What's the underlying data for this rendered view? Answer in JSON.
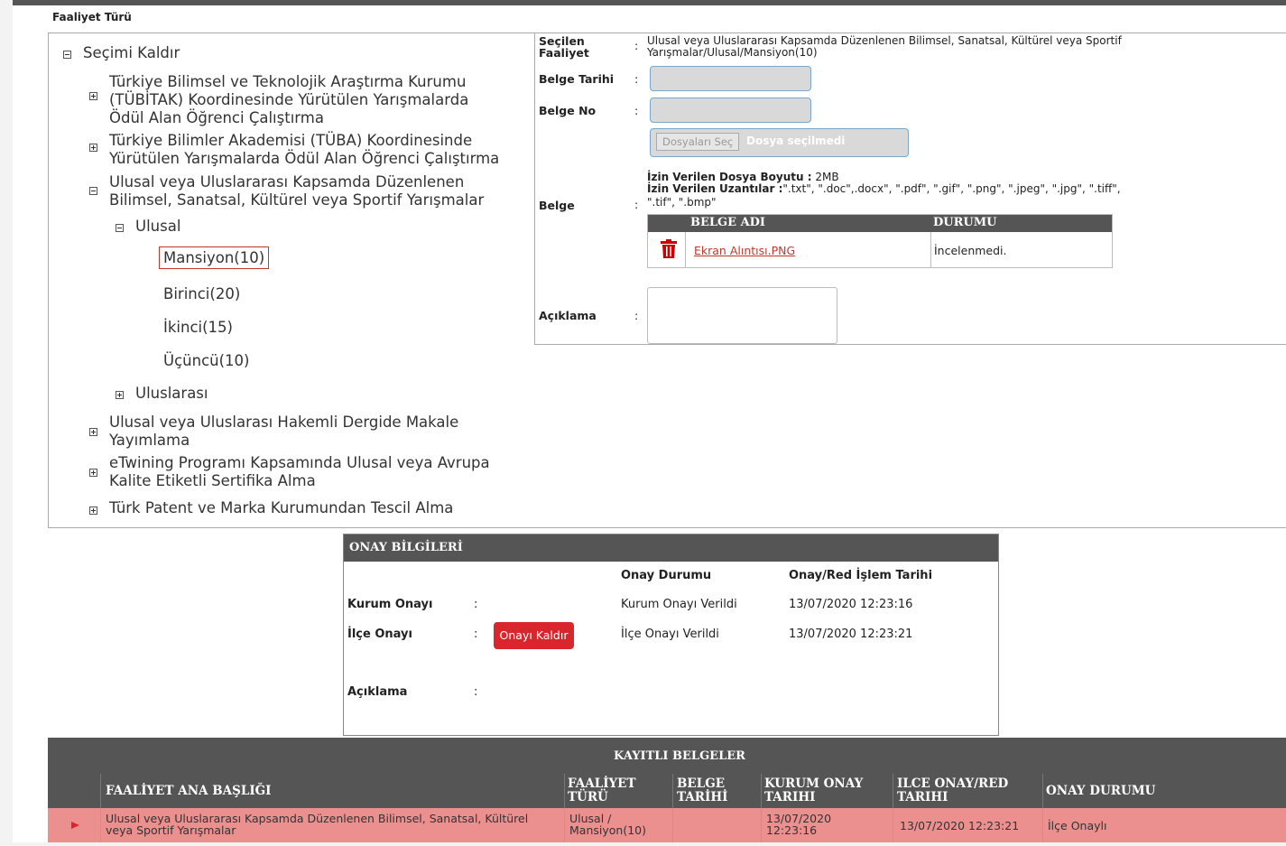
{
  "fieldset_title": "Faaliyet Türü",
  "tree": {
    "clear_selection": "Seçimi Kaldır",
    "items": [
      "Türkiye Bilimsel ve Teknolojik Araştırma Kurumu",
      "(TÜBİTAK) Koordinesinde Yürütülen Yarışmalarda",
      "Ödül Alan Öğrenci Çalıştırma",
      "Türkiye Bilimler Akademisi (TÜBA) Koordinesinde",
      "Yürütülen Yarışmalarda Ödül Alan Öğrenci Çalıştırma",
      "Ulusal veya Uluslararası Kapsamda Düzenlenen",
      "Bilimsel, Sanatsal, Kültürel veya Sportif Yarışmalar",
      "Ulusal",
      "Mansiyon(10)",
      "Birinci(20)",
      "İkinci(15)",
      "Üçüncü(10)",
      "Uluslarası",
      "Ulusal veya Uluslarası Hakemli Dergide Makale",
      "Yayımlama",
      "eTwining Programı Kapsamında Ulusal veya Avrupa",
      "Kalite Etiketli Sertifika Alma",
      "Türk Patent ve Marka Kurumundan Tescil Alma"
    ]
  },
  "detail": {
    "secilen_label_1": "Seçilen",
    "secilen_label_2": "Faaliyet",
    "secilen_value_1": "Ulusal veya Uluslararası Kapsamda Düzenlenen Bilimsel, Sanatsal, Kültürel veya Sportif",
    "secilen_value_2": "Yarışmalar/Ulusal/Mansiyon(10)",
    "belge_tarihi_label": "Belge Tarihi",
    "belge_no_label": "Belge No",
    "file_button": "Dosyaları Seç",
    "file_status": "Dosya seçilmedi",
    "izin_boyut_label": "İzin Verilen Dosya Boyutu :",
    "izin_boyut_value": "2MB",
    "izin_uzanti_label": "İzin Verilen Uzantılar :",
    "izin_uzanti_value_1": "\".txt\", \".doc\",.docx\", \".pdf\", \".gif\", \".png\", \".jpeg\", \".jpg\", \".tiff\",",
    "izin_uzanti_value_2": "\".tif\", \".bmp\"",
    "belge_label": "Belge",
    "col_belge_adi": "BELGE ADI",
    "col_durumu": "DURUMU",
    "file_name": "Ekran Alıntısı.PNG",
    "file_status_text": "İncelenmedi.",
    "aciklama_label": "Açıklama",
    "colon": ":"
  },
  "onay": {
    "title": "ONAY BİLGİLERİ",
    "col_durum": "Onay Durumu",
    "col_tarih": "Onay/Red İşlem Tarihi",
    "kurum_label": "Kurum Onayı",
    "kurum_durum": "Kurum Onayı Verildi",
    "kurum_tarih": "13/07/2020 12:23:16",
    "ilce_label": "İlçe Onayı",
    "ilce_button": "Onayı Kaldır",
    "ilce_durum": "İlçe Onayı Verildi",
    "ilce_tarih": "13/07/2020 12:23:21",
    "aciklama_label": "Açıklama",
    "colon": ":"
  },
  "kayitli": {
    "title": "KAYITLI BELGELER",
    "columns": {
      "ana_baslik": "FAALİYET ANA BAŞLIĞI",
      "turu_1": "FAALİYET",
      "turu_2": "TÜRÜ",
      "belge_1": "BELGE",
      "belge_2": "TARİHİ",
      "kurum_1": "KURUM ONAY",
      "kurum_2": "TARIHI",
      "ilce_1": "ILCE ONAY/RED",
      "ilce_2": "TARIHI",
      "durum": "ONAY DURUMU"
    },
    "row": {
      "ana_baslik_1": "Ulusal veya Uluslararası Kapsamda Düzenlenen Bilimsel, Sanatsal, Kültürel",
      "ana_baslik_2": "veya Sportif Yarışmalar",
      "turu_1": "Ulusal /",
      "turu_2": "Mansiyon(10)",
      "kurum_1": "13/07/2020",
      "kurum_2": "12:23:16",
      "ilce": "13/07/2020 12:23:21",
      "durum": "İlçe Onaylı"
    }
  },
  "colors": {
    "header_gray": "#555555",
    "row_highlight": "#ec8f8f",
    "danger": "#d9262c"
  }
}
